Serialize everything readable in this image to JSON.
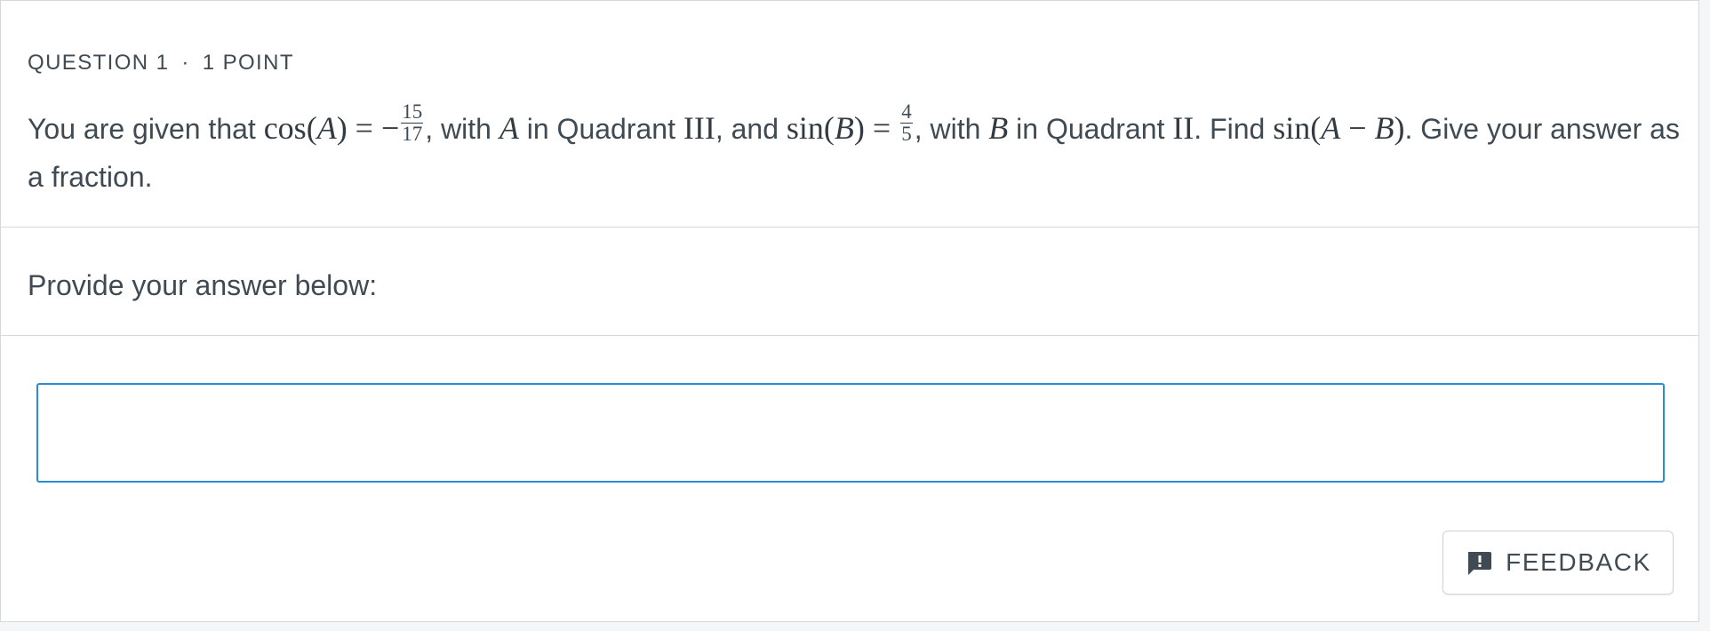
{
  "question": {
    "number_label": "QUESTION 1",
    "separator": "·",
    "points_label": "1 POINT",
    "text_parts": {
      "t1": "You are given that ",
      "cos": "cos",
      "A1": "A",
      "eq1": ") = −",
      "frac1_num": "15",
      "frac1_den": "17",
      "t2": ", with ",
      "A2": "A",
      "t3": " in Quadrant ",
      "q3": "III",
      "t4": ", and ",
      "sin1": "sin",
      "B1": "B",
      "eq2": ") = ",
      "frac2_num": "4",
      "frac2_den": "5",
      "t5": ", with ",
      "B2": "B",
      "t6": " in Quadrant ",
      "q2": "II",
      "t7": ". Find ",
      "sin2": "sin",
      "A3": "A",
      "minus": " − ",
      "B3": "B",
      "t8": ". Give your answer as a fraction."
    }
  },
  "prompt": {
    "label": "Provide your answer below:"
  },
  "answer": {
    "value": "",
    "placeholder": ""
  },
  "feedback": {
    "label": "FEEDBACK",
    "icon": "feedback-icon"
  },
  "colors": {
    "accent": "#2a8dd4",
    "text": "#3f4a52",
    "border": "#d6d9dc"
  }
}
